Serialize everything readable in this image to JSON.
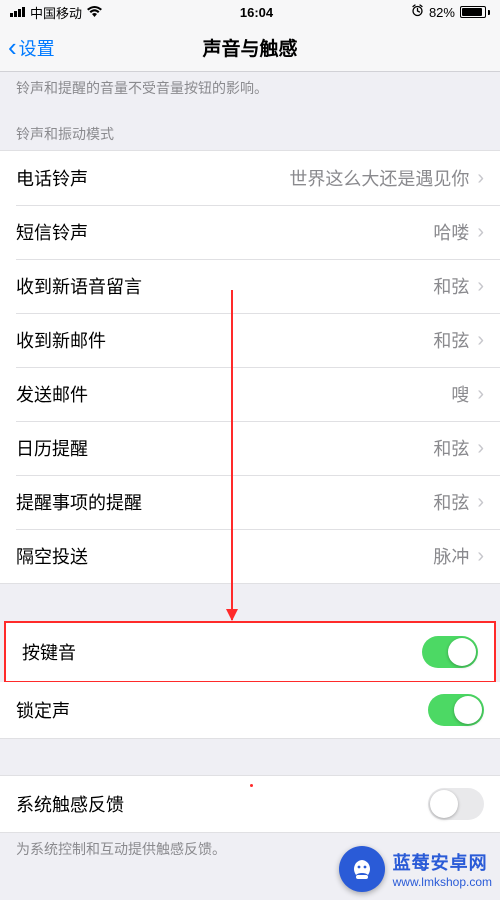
{
  "status": {
    "carrier": "中国移动",
    "time": "16:04",
    "battery_pct": "82%"
  },
  "nav": {
    "back_label": "设置",
    "title": "声音与触感"
  },
  "note_top": "铃声和提醒的音量不受音量按钮的影响。",
  "section_ring": "铃声和振动模式",
  "rows": {
    "ringtone": {
      "label": "电话铃声",
      "value": "世界这么大还是遇见你"
    },
    "sms": {
      "label": "短信铃声",
      "value": "哈喽"
    },
    "voicemail": {
      "label": "收到新语音留言",
      "value": "和弦"
    },
    "newmail": {
      "label": "收到新邮件",
      "value": "和弦"
    },
    "sentmail": {
      "label": "发送邮件",
      "value": "嗖"
    },
    "calendar": {
      "label": "日历提醒",
      "value": "和弦"
    },
    "reminder": {
      "label": "提醒事项的提醒",
      "value": "和弦"
    },
    "airdrop": {
      "label": "隔空投送",
      "value": "脉冲"
    }
  },
  "toggles": {
    "keyboard": {
      "label": "按键音",
      "on": true
    },
    "lock": {
      "label": "锁定声",
      "on": true
    },
    "haptic": {
      "label": "系统触感反馈",
      "on": false
    }
  },
  "note_haptic": "为系统控制和互动提供触感反馈。",
  "watermark": {
    "name": "蓝莓安卓网",
    "url": "www.lmkshop.com"
  }
}
